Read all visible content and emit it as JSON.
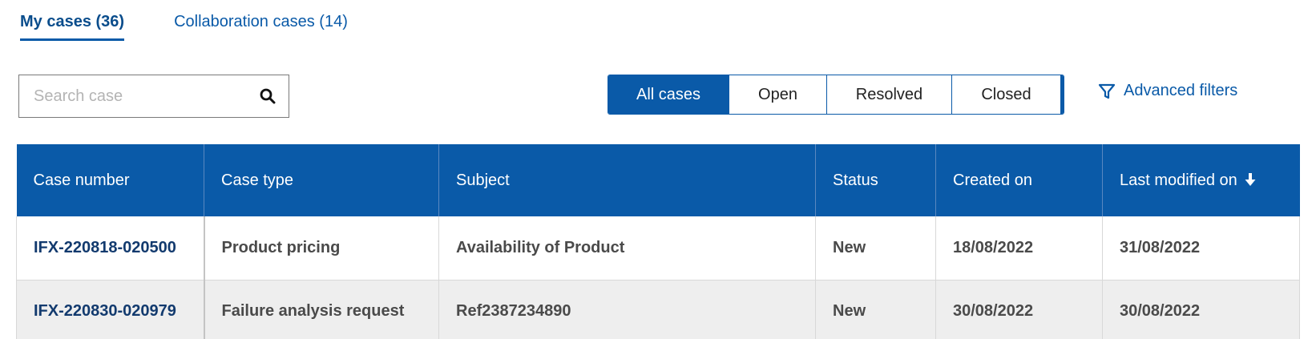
{
  "tabs": [
    {
      "label": "My cases (36)",
      "active": true
    },
    {
      "label": "Collaboration cases (14)",
      "active": false
    }
  ],
  "search": {
    "placeholder": "Search case",
    "value": "",
    "icon": "search-icon"
  },
  "filters": {
    "buttons": [
      {
        "label": "All cases",
        "active": true
      },
      {
        "label": "Open",
        "active": false
      },
      {
        "label": "Resolved",
        "active": false
      },
      {
        "label": "Closed",
        "active": false
      }
    ],
    "advanced_label": "Advanced filters",
    "advanced_icon": "filter-icon"
  },
  "table": {
    "headers": [
      "Case number",
      "Case type",
      "Subject",
      "Status",
      "Created on",
      "Last modified on"
    ],
    "sort_icon": "arrow-down-icon",
    "rows": [
      [
        "IFX-220818-020500",
        "Product pricing",
        "Availability of Product",
        "New",
        "18/08/2022",
        "31/08/2022"
      ],
      [
        "IFX-220830-020979",
        "Failure analysis request",
        "Ref2387234890",
        "New",
        "30/08/2022",
        "30/08/2022"
      ]
    ]
  },
  "colors": {
    "primary": "#0a5aa8",
    "row_alt": "#eeeeee"
  }
}
